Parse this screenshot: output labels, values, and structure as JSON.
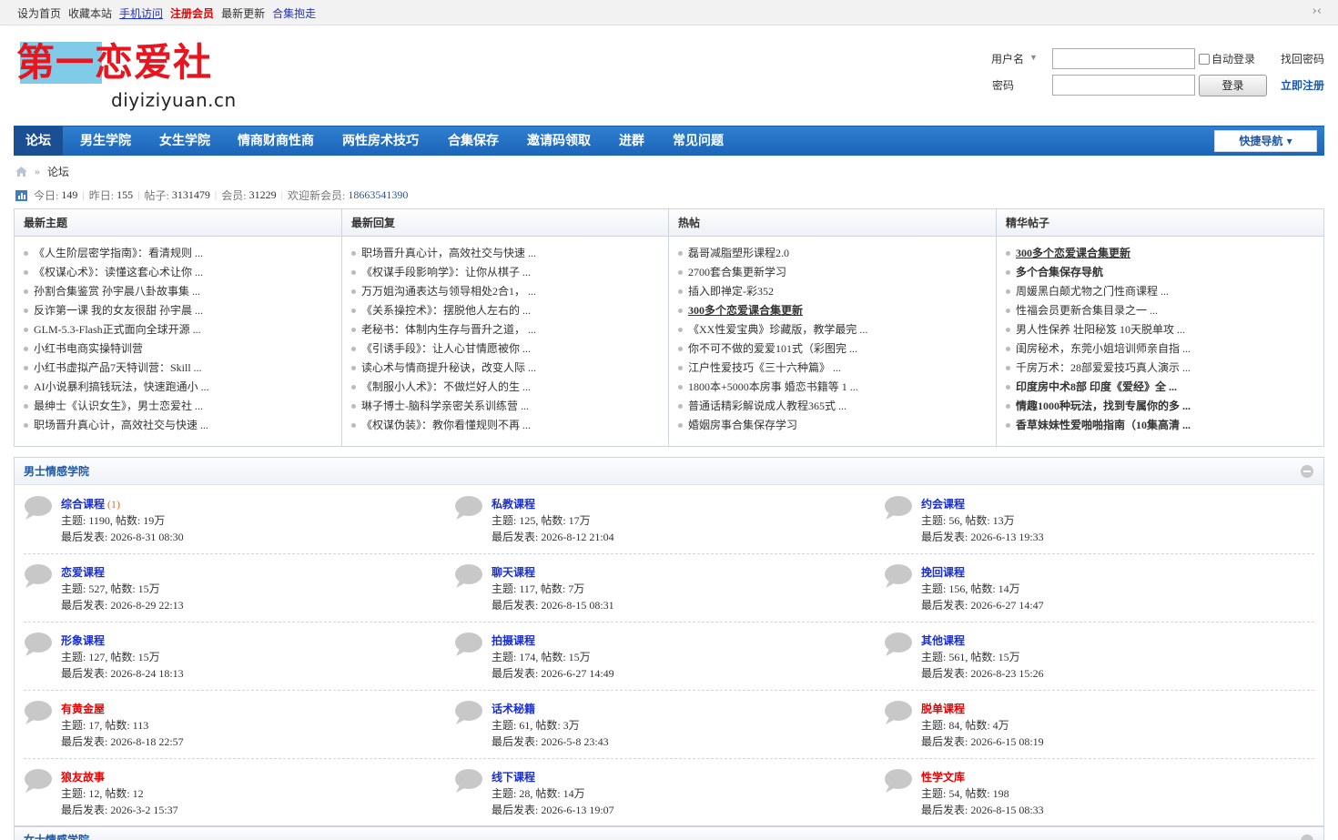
{
  "topbar": {
    "links": [
      "设为首页",
      "收藏本站",
      "手机访问",
      "注册会员",
      "最新更新",
      "合集抱走"
    ],
    "collapse": "›‹"
  },
  "logo": {
    "zh": "第一恋爱社",
    "en": "diyiziyuan.cn"
  },
  "login": {
    "username_label": "用户名",
    "password_label": "密码",
    "auto_login": "自动登录",
    "login_button": "登录",
    "forgot": "找回密码",
    "register": "立即注册"
  },
  "nav": {
    "items": [
      "论坛",
      "男生学院",
      "女生学院",
      "情商财商性商",
      "两性房术技巧",
      "合集保存",
      "邀请码领取",
      "进群",
      "常见问题"
    ],
    "quick": "快捷导航"
  },
  "breadcrumb": {
    "sep": "»",
    "current": "论坛"
  },
  "stats": {
    "today_label": "今日:",
    "today": "149",
    "yesterday_label": "昨日:",
    "yesterday": "155",
    "posts_label": "帖子:",
    "posts": "3131479",
    "members_label": "会员:",
    "members": "31229",
    "welcome_label": "欢迎新会员:",
    "welcome": "18663541390"
  },
  "columns": [
    {
      "title": "最新主题",
      "items": [
        {
          "t": "《人生阶层密学指南》：看清规则 ...",
          "c": ""
        },
        {
          "t": "《权谋心术》：读懂这套心术让你 ...",
          "c": ""
        },
        {
          "t": "孙割合集鉴赏 孙宇晨八卦故事集 ...",
          "c": ""
        },
        {
          "t": "反诈第一课 我的女友很甜 孙宇晨 ...",
          "c": ""
        },
        {
          "t": "GLM-5.3-Flash正式面向全球开源 ...",
          "c": ""
        },
        {
          "t": "小红书电商实操特训营",
          "c": ""
        },
        {
          "t": "小红书虚拟产品7天特训营：Skill ...",
          "c": ""
        },
        {
          "t": "AI小说暴利搞钱玩法，快速跑通小 ...",
          "c": ""
        },
        {
          "t": "最绅士《认识女生》，男士恋爱社 ...",
          "c": ""
        },
        {
          "t": "职场晋升真心计，高效社交与快速 ...",
          "c": ""
        }
      ]
    },
    {
      "title": "最新回复",
      "items": [
        {
          "t": "职场晋升真心计，高效社交与快速 ...",
          "c": ""
        },
        {
          "t": "《权谋手段影响学》：让你从棋子 ...",
          "c": ""
        },
        {
          "t": "万万姐沟通表达与领导相处2合1， ...",
          "c": ""
        },
        {
          "t": "《关系操控术》：摆脱他人左右的 ...",
          "c": ""
        },
        {
          "t": "老秘书：体制内生存与晋升之道， ...",
          "c": ""
        },
        {
          "t": "《引诱手段》：让人心甘情愿被你 ...",
          "c": ""
        },
        {
          "t": "读心术与情商提升秘诀，改变人际 ...",
          "c": ""
        },
        {
          "t": "《制服小人术》：不做烂好人的生 ...",
          "c": ""
        },
        {
          "t": "琳子博士-脑科学亲密关系训练营 ...",
          "c": ""
        },
        {
          "t": "《权谋伪装》：教你看懂规则不再 ...",
          "c": ""
        }
      ]
    },
    {
      "title": "热帖",
      "items": [
        {
          "t": "磊哥减脂塑形课程2.0",
          "c": ""
        },
        {
          "t": "2700套合集更新学习",
          "c": ""
        },
        {
          "t": "插入即禅定-彩352",
          "c": ""
        },
        {
          "t": "300多个恋爱课合集更新",
          "c": "bl"
        },
        {
          "t": "《XX性爱宝典》珍藏版，教学最完 ...",
          "c": "teal"
        },
        {
          "t": "你不可不做的爱爱101式（彩图完 ...",
          "c": ""
        },
        {
          "t": "江户性爱技巧《三十六种篇》 ...",
          "c": "lred"
        },
        {
          "t": "1800本+5000本房事 婚恋书籍等 1 ...",
          "c": ""
        },
        {
          "t": "普通话精彩解说成人教程365式 ...",
          "c": ""
        },
        {
          "t": "婚姻房事合集保存学习",
          "c": "lred"
        }
      ]
    },
    {
      "title": "精华帖子",
      "items": [
        {
          "t": "300多个恋爱课合集更新",
          "c": "bl"
        },
        {
          "t": "多个合集保存导航",
          "c": "red"
        },
        {
          "t": "周媛黑白颠尤物之门性商课程 ...",
          "c": "orange"
        },
        {
          "t": "性福会员更新合集目录之一 ...",
          "c": "pink"
        },
        {
          "t": "男人性保养 壮阳秘笈 10天脱单攻 ...",
          "c": ""
        },
        {
          "t": "闺房秘术，东莞小姐培训师亲自指 ...",
          "c": ""
        },
        {
          "t": "千房万术：28部爱爱技巧真人演示 ...",
          "c": "green"
        },
        {
          "t": "印度房中术8部 印度《爱经》全 ...",
          "c": "darkred"
        },
        {
          "t": "情趣1000种玩法，找到专属你的多 ...",
          "c": "orb"
        },
        {
          "t": "香草妹妹性爱啪啪指南（10集高清 ...",
          "c": "blb"
        }
      ]
    }
  ],
  "section": {
    "title": "男士情感学院",
    "forums": [
      {
        "name": "综合课程",
        "cnt": "(1)",
        "meta": "主题: 1190, 帖数: 19万",
        "last": "最后发表: 2026-8-31 08:30",
        "hot": false
      },
      {
        "name": "私教课程",
        "cnt": "",
        "meta": "主题: 125, 帖数: 17万",
        "last": "最后发表: 2026-8-12 21:04",
        "hot": false
      },
      {
        "name": "约会课程",
        "cnt": "",
        "meta": "主题: 56, 帖数: 13万",
        "last": "最后发表: 2026-6-13 19:33",
        "hot": false
      },
      {
        "name": "恋爱课程",
        "cnt": "",
        "meta": "主题: 527, 帖数: 15万",
        "last": "最后发表: 2026-8-29 22:13",
        "hot": false
      },
      {
        "name": "聊天课程",
        "cnt": "",
        "meta": "主题: 117, 帖数: 7万",
        "last": "最后发表: 2026-8-15 08:31",
        "hot": false
      },
      {
        "name": "挽回课程",
        "cnt": "",
        "meta": "主题: 156, 帖数: 14万",
        "last": "最后发表: 2026-6-27 14:47",
        "hot": false
      },
      {
        "name": "形象课程",
        "cnt": "",
        "meta": "主题: 127, 帖数: 15万",
        "last": "最后发表: 2026-8-24 18:13",
        "hot": false
      },
      {
        "name": "拍摄课程",
        "cnt": "",
        "meta": "主题: 174, 帖数: 15万",
        "last": "最后发表: 2026-6-27 14:49",
        "hot": false
      },
      {
        "name": "其他课程",
        "cnt": "",
        "meta": "主题: 561, 帖数: 15万",
        "last": "最后发表: 2026-8-23 15:26",
        "hot": false
      },
      {
        "name": "有黄金屋",
        "cnt": "",
        "meta": "主题: 17, 帖数: 113",
        "last": "最后发表: 2026-8-18 22:57",
        "hot": true
      },
      {
        "name": "话术秘籍",
        "cnt": "",
        "meta": "主题: 61, 帖数: 3万",
        "last": "最后发表: 2026-5-8 23:43",
        "hot": false
      },
      {
        "name": "脱单课程",
        "cnt": "",
        "meta": "主题: 84, 帖数: 4万",
        "last": "最后发表: 2026-6-15 08:19",
        "hot": true
      },
      {
        "name": "狼友故事",
        "cnt": "",
        "meta": "主题: 12, 帖数: 12",
        "last": "最后发表: 2026-3-2 15:37",
        "hot": true
      },
      {
        "name": "线下课程",
        "cnt": "",
        "meta": "主题: 28, 帖数: 14万",
        "last": "最后发表: 2026-6-13 19:07",
        "hot": false
      },
      {
        "name": "性学文库",
        "cnt": "",
        "meta": "主题: 54, 帖数: 198",
        "last": "最后发表: 2026-8-15 08:33",
        "hot": true
      }
    ]
  },
  "section2": {
    "title": "女士情感学院"
  }
}
